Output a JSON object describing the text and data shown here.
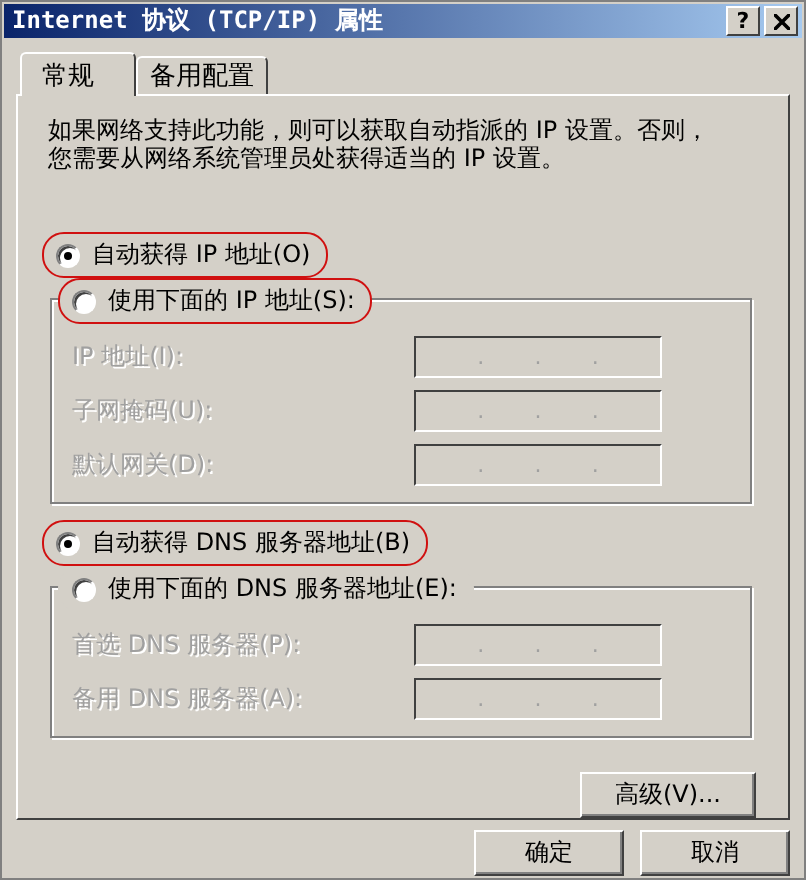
{
  "window": {
    "title": "Internet 协议 (TCP/IP) 属性",
    "help_label": "?"
  },
  "tabs": [
    {
      "label": "常规",
      "selected": true
    },
    {
      "label": "备用配置",
      "selected": false
    }
  ],
  "intro_lines": [
    "如果网络支持此功能，则可以获取自动指派的 IP 设置。否则，",
    "您需要从网络系统管理员处获得适当的 IP 设置。"
  ],
  "ip_options": [
    {
      "label": "自动获得 IP 地址(O)",
      "selected": true,
      "circled": true
    },
    {
      "label": "使用下面的 IP 地址(S):",
      "selected": false,
      "circled": true
    }
  ],
  "ip_fields": [
    {
      "label": "IP 地址(I):",
      "disabled": true,
      "dots": [
        ".",
        ".",
        "."
      ]
    },
    {
      "label": "子网掩码(U):",
      "disabled": true,
      "dots": [
        ".",
        ".",
        "."
      ]
    },
    {
      "label": "默认网关(D):",
      "disabled": true,
      "dots": [
        ".",
        ".",
        "."
      ]
    }
  ],
  "dns_options": [
    {
      "label": "自动获得 DNS 服务器地址(B)",
      "selected": true,
      "circled": true
    },
    {
      "label": "使用下面的 DNS 服务器地址(E):",
      "selected": false,
      "circled": false
    }
  ],
  "dns_fields": [
    {
      "label": "首选 DNS 服务器(P):",
      "disabled": true,
      "dots": [
        ".",
        ".",
        "."
      ]
    },
    {
      "label": "备用 DNS 服务器(A):",
      "disabled": true,
      "dots": [
        ".",
        ".",
        "."
      ]
    }
  ],
  "advanced_button": "高级(V)...",
  "footer_buttons": [
    "确定",
    "取消"
  ]
}
